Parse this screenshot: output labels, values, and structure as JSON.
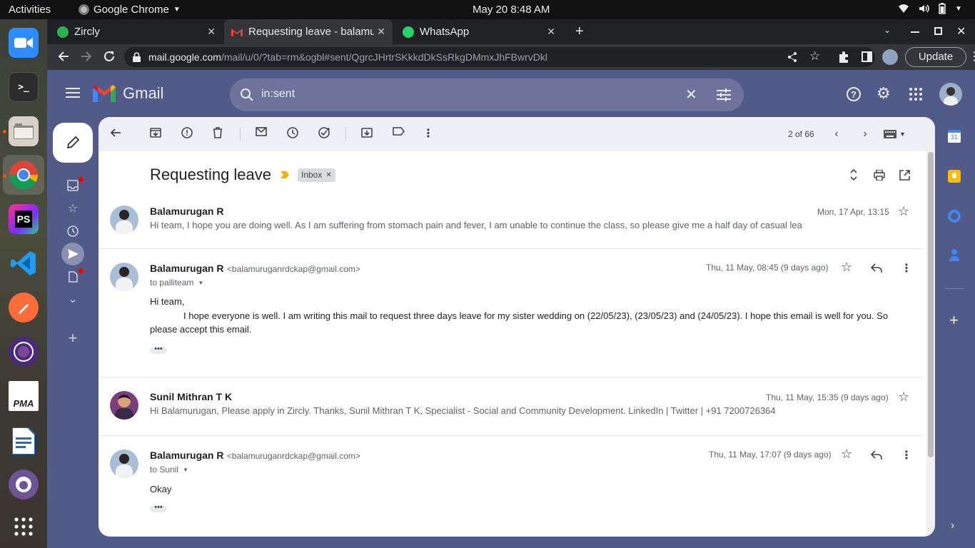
{
  "topbar": {
    "activities": "Activities",
    "app": "Google Chrome",
    "datetime": "May 20   8:48 AM"
  },
  "dock": {
    "items": [
      "zoom",
      "terminal",
      "files",
      "chrome",
      "phpstorm",
      "vscode",
      "postman",
      "tor",
      "pma",
      "libreoffice-writer",
      "github",
      "app-grid"
    ]
  },
  "tabs": [
    {
      "title": "Zircly"
    },
    {
      "title": "Requesting leave - balamu"
    },
    {
      "title": "WhatsApp"
    }
  ],
  "address": {
    "host": "mail.google.com",
    "path": "/mail/u/0/?tab=rm&ogbl#sent/QgrcJHrtrSKkkdDkSsRkgDMmxJhFBwrvDkl"
  },
  "browser": {
    "update_label": "Update"
  },
  "gmail": {
    "logo": "Gmail",
    "search_query": "in:sent",
    "pager": "2 of 66",
    "subject": "Requesting leave",
    "label": "Inbox"
  },
  "messages": [
    {
      "sender": "Balamurugan R",
      "date": "Mon, 17 Apr, 13:15",
      "snippet": "Hi team, I hope you are doing well. As I am suffering from stomach pain and fever, I am unable to continue the class, so please give me a half day of casual lea"
    },
    {
      "sender": "Balamurugan R",
      "email": "<balamuruganrdckap@gmail.com>",
      "date": "Thu, 11 May, 08:45 (9 days ago)",
      "to": "to palliteam",
      "body_greeting": "Hi team,",
      "body_line1": "I hope everyone is well. I am writing this mail to request three days leave for my sister wedding on (22/05/23), (23/05/23) and (24/05/23). I hope this email is well for you. So",
      "body_line2": "please accept this email."
    },
    {
      "sender": "Sunil Mithran T K",
      "date": "Thu, 11 May, 15:35 (9 days ago)",
      "snippet": "Hi Balamurugan, Please apply in Zircly. Thanks, Sunil Mithran T K, Specialist - Social and Community Development. LinkedIn | Twitter | +91 7200726364"
    },
    {
      "sender": "Balamurugan R",
      "email": "<balamuruganrdckap@gmail.com>",
      "date": "Thu, 11 May, 17:07 (9 days ago)",
      "to": "to Sunil",
      "body": "Okay"
    }
  ],
  "colors": {
    "gmail_bg": "#525a87",
    "panel_toolbar": "#eef0f6",
    "label_chip": "#dadce0",
    "important_marker": "#f4b400"
  }
}
